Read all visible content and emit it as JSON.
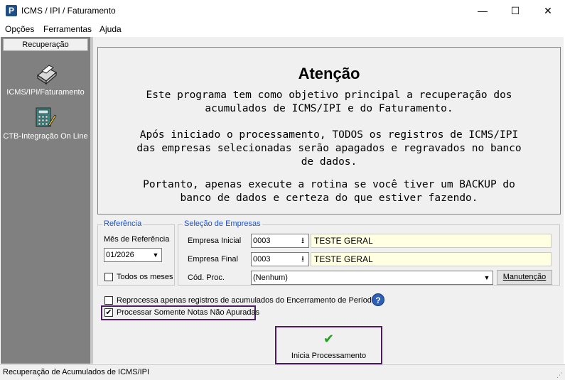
{
  "window": {
    "title": "ICMS / IPI / Faturamento",
    "app_icon_letter": "P",
    "minimize": "—",
    "maximize": "☐",
    "close": "✕"
  },
  "menu": {
    "items": [
      "Opções",
      "Ferramentas",
      "Ajuda"
    ]
  },
  "sidebar": {
    "header": "Recuperação",
    "items": [
      {
        "label": "ICMS/IPI/Faturamento",
        "icon": "printer-icon"
      },
      {
        "label": "CTB-Integração On Line",
        "icon": "calculator-icon"
      }
    ]
  },
  "warning": {
    "title": "Atenção",
    "p1": "Este programa tem como objetivo principal a recuperação dos\nacumulados de ICMS/IPI e do Faturamento.",
    "p2": "Após iniciado o processamento, TODOS os registros de ICMS/IPI\ndas empresas selecionadas serão apagados e regravados no banco\nde dados.",
    "p3": "Portanto, apenas execute a rotina se você tiver um BACKUP do\nbanco de dados e certeza do que estiver fazendo."
  },
  "referencia": {
    "title": "Referência",
    "mes_label": "Mês de Referência",
    "mes_value": "01/2026",
    "todos_label": "Todos os meses",
    "todos_checked": false
  },
  "selecao": {
    "title": "Seleção de Empresas",
    "inicial_label": "Empresa Inicial",
    "inicial_code": "0003",
    "inicial_name": "TESTE GERAL",
    "final_label": "Empresa Final",
    "final_code": "0003",
    "final_name": "TESTE GERAL",
    "proc_label": "Cód. Proc.",
    "proc_value": "(Nenhum)",
    "manutencao_label": "Manutenção"
  },
  "options": {
    "reprocessa_label": "Reprocessa apenas registros de acumulados do Encerramento de Período",
    "reprocessa_checked": false,
    "somente_label": "Processar Somente Notas Não Apuradas",
    "somente_checked": true,
    "help_symbol": "?"
  },
  "run_button": {
    "label": "Inicia Processamento",
    "check_symbol": "✔"
  },
  "status": {
    "text": "Recuperação de Acumulados de ICMS/IPI"
  },
  "colors": {
    "accent": "#1f52c0",
    "highlight_border": "#4b1d5e",
    "yellow": "#ffffe1",
    "sidebar": "#808080",
    "check_green": "#1aa01a"
  }
}
